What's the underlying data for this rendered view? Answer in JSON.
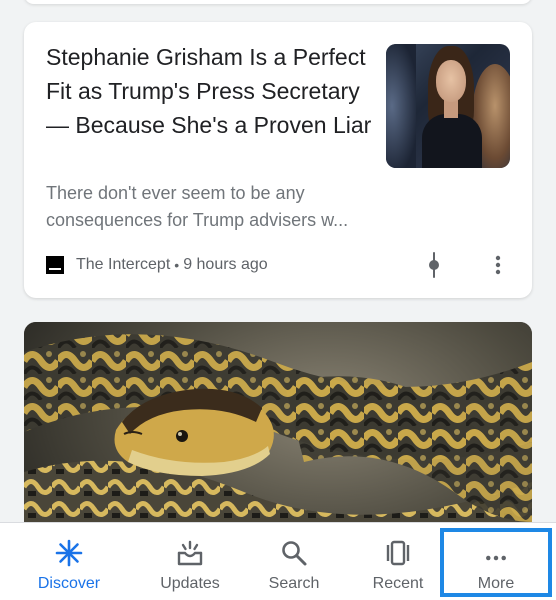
{
  "article": {
    "headline": "Stephanie Grisham Is a Perfect Fit as Trump's Press Secretary — Because She's a Proven Liar",
    "snippet": "There don't ever seem to be any consequences for Trump advisers w...",
    "source": "The Intercept",
    "separator": "•",
    "time": "9 hours ago"
  },
  "bottom_nav": {
    "items": [
      {
        "label": "Discover",
        "icon": "discover-asterisk-icon",
        "active": true
      },
      {
        "label": "Updates",
        "icon": "updates-tray-icon",
        "active": false
      },
      {
        "label": "Search",
        "icon": "search-icon",
        "active": false
      },
      {
        "label": "Recent",
        "icon": "recent-cards-icon",
        "active": false
      },
      {
        "label": "More",
        "icon": "more-dots-icon",
        "active": false,
        "highlighted": true
      }
    ]
  },
  "colors": {
    "accent": "#1a73e8",
    "highlight_box": "#1e88e5",
    "text_primary": "#202124",
    "text_secondary": "#5f6368"
  }
}
